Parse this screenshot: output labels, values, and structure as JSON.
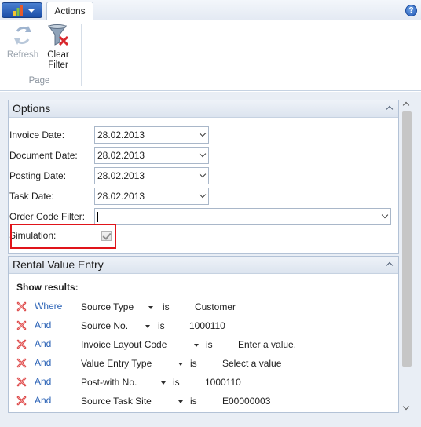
{
  "ribbon": {
    "tabs": [
      {
        "label": "Actions"
      }
    ],
    "help_label": "?",
    "buttons": {
      "refresh_label_1": "Refresh",
      "clear_filter_label_1": "Clear",
      "clear_filter_label_2": "Filter"
    },
    "group_label": "Page"
  },
  "options": {
    "title": "Options",
    "fields": {
      "invoice_date": {
        "label": "Invoice Date:",
        "value": "28.02.2013"
      },
      "document_date": {
        "label": "Document Date:",
        "value": "28.02.2013"
      },
      "posting_date": {
        "label": "Posting Date:",
        "value": "28.02.2013"
      },
      "task_date": {
        "label": "Task Date:",
        "value": "28.02.2013"
      },
      "order_code_filter": {
        "label": "Order Code Filter:",
        "value": ""
      },
      "simulation": {
        "label": "Simulation:",
        "checked": true
      }
    }
  },
  "rental_value_entry": {
    "title": "Rental Value Entry",
    "show_results_label": "Show results:",
    "filters": [
      {
        "conj": "Where",
        "field": "Source Type",
        "op": "is",
        "value": "Customer"
      },
      {
        "conj": "And",
        "field": "Source No.",
        "op": "is",
        "value": "1000110"
      },
      {
        "conj": "And",
        "field": "Invoice Layout Code",
        "op": "is",
        "value": "Enter a value."
      },
      {
        "conj": "And",
        "field": "Value Entry Type",
        "op": "is",
        "value": "Select a value"
      },
      {
        "conj": "And",
        "field": "Post-with No.",
        "op": "is",
        "value": "1000110"
      },
      {
        "conj": "And",
        "field": "Source Task Site",
        "op": "is",
        "value": "E00000003"
      }
    ]
  },
  "colors": {
    "accent_blue": "#2a62b6",
    "highlight_red": "#e0141a",
    "delete_red": "#d83a3a"
  }
}
